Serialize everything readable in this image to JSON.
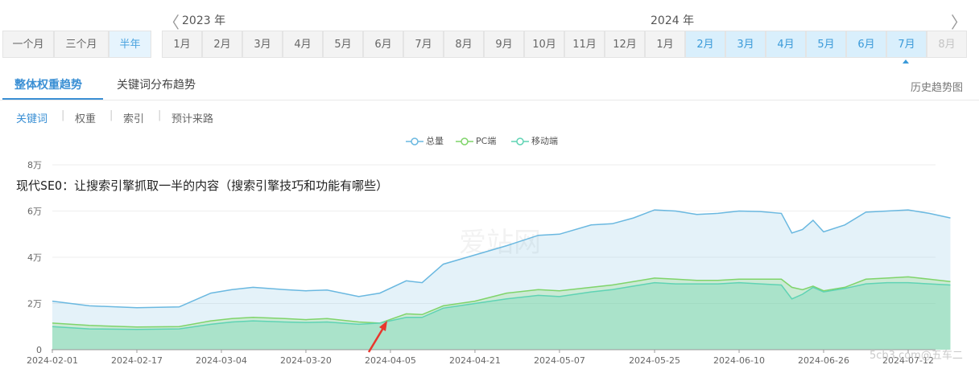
{
  "header": {
    "prev_arrow": "〈",
    "next_arrow": "〉",
    "year_2023": "2023 年",
    "year_2024": "2024 年",
    "range_buttons": [
      "一个月",
      "三个月",
      "半年"
    ],
    "months": [
      "1月",
      "2月",
      "3月",
      "4月",
      "5月",
      "6月",
      "7月",
      "8月",
      "9月",
      "10月",
      "11月",
      "12月",
      "1月",
      "2月",
      "3月",
      "4月",
      "5月",
      "6月",
      "7月",
      "8月"
    ]
  },
  "tabs": [
    "整体权重趋势",
    "关键词分布趋势"
  ],
  "history_link": "历史趋势图",
  "subtabs": [
    "关键词",
    "权重",
    "索引",
    "预计来路"
  ],
  "sep": "|",
  "overlay_title": "现代SEO：让搜索引擎抓取一半的内容（搜索引擎技巧和功能有哪些）",
  "watermark_text": "爱站网",
  "corner_watermark": "5cb3.com@五车二",
  "colors": {
    "total": "#6ab8e0",
    "pc": "#7fd46a",
    "mobile": "#5fd3b4",
    "accent": "#3a8fd4"
  },
  "chart_data": {
    "type": "area",
    "legend": [
      "总量",
      "PC端",
      "移动端"
    ],
    "x_ticks": [
      "2024-02-01",
      "2024-02-17",
      "2024-03-04",
      "2024-03-20",
      "2024-04-05",
      "2024-04-21",
      "2024-05-07",
      "2024-05-25",
      "2024-06-10",
      "2024-06-26",
      "2024-07-12"
    ],
    "y_ticks": [
      "0",
      "2万",
      "4万",
      "6万",
      "8万"
    ],
    "ylim": [
      0,
      80000
    ],
    "series": [
      {
        "name": "总量",
        "x": [
          "2024-02-01",
          "2024-02-08",
          "2024-02-17",
          "2024-02-25",
          "2024-03-02",
          "2024-03-06",
          "2024-03-10",
          "2024-03-16",
          "2024-03-20",
          "2024-03-24",
          "2024-03-30",
          "2024-04-03",
          "2024-04-08",
          "2024-04-11",
          "2024-04-15",
          "2024-04-21",
          "2024-04-27",
          "2024-05-03",
          "2024-05-07",
          "2024-05-13",
          "2024-05-17",
          "2024-05-21",
          "2024-05-25",
          "2024-05-29",
          "2024-06-02",
          "2024-06-06",
          "2024-06-10",
          "2024-06-14",
          "2024-06-18",
          "2024-06-20",
          "2024-06-22",
          "2024-06-24",
          "2024-06-26",
          "2024-06-30",
          "2024-07-04",
          "2024-07-08",
          "2024-07-12",
          "2024-07-16",
          "2024-07-20"
        ],
        "values": [
          21000,
          19000,
          18200,
          18500,
          24500,
          26000,
          27000,
          26000,
          25500,
          25800,
          23000,
          24500,
          29800,
          29000,
          37000,
          41000,
          45000,
          49500,
          50000,
          54000,
          54500,
          57000,
          60500,
          60000,
          58500,
          59000,
          60000,
          59800,
          59000,
          50500,
          52000,
          56000,
          51000,
          54000,
          59500,
          60000,
          60500,
          59000,
          57000
        ]
      },
      {
        "name": "PC端",
        "x": [
          "2024-02-01",
          "2024-02-08",
          "2024-02-17",
          "2024-02-25",
          "2024-03-02",
          "2024-03-06",
          "2024-03-10",
          "2024-03-16",
          "2024-03-20",
          "2024-03-24",
          "2024-03-30",
          "2024-04-03",
          "2024-04-08",
          "2024-04-11",
          "2024-04-15",
          "2024-04-21",
          "2024-04-27",
          "2024-05-03",
          "2024-05-07",
          "2024-05-13",
          "2024-05-17",
          "2024-05-21",
          "2024-05-25",
          "2024-05-29",
          "2024-06-02",
          "2024-06-06",
          "2024-06-10",
          "2024-06-14",
          "2024-06-18",
          "2024-06-20",
          "2024-06-22",
          "2024-06-24",
          "2024-06-26",
          "2024-06-30",
          "2024-07-04",
          "2024-07-08",
          "2024-07-12",
          "2024-07-16",
          "2024-07-20"
        ],
        "values": [
          11500,
          10500,
          9800,
          10000,
          12500,
          13500,
          14000,
          13500,
          13000,
          13500,
          12000,
          11500,
          15500,
          15200,
          19000,
          21000,
          24500,
          26000,
          25500,
          27000,
          28000,
          29500,
          31000,
          30500,
          30000,
          30000,
          30500,
          30500,
          30500,
          27000,
          26000,
          27500,
          25500,
          27000,
          30500,
          31000,
          31500,
          30500,
          29500
        ]
      },
      {
        "name": "移动端",
        "x": [
          "2024-02-01",
          "2024-02-08",
          "2024-02-17",
          "2024-02-25",
          "2024-03-02",
          "2024-03-06",
          "2024-03-10",
          "2024-03-16",
          "2024-03-20",
          "2024-03-24",
          "2024-03-30",
          "2024-04-03",
          "2024-04-08",
          "2024-04-11",
          "2024-04-15",
          "2024-04-21",
          "2024-04-27",
          "2024-05-03",
          "2024-05-07",
          "2024-05-13",
          "2024-05-17",
          "2024-05-21",
          "2024-05-25",
          "2024-05-29",
          "2024-06-02",
          "2024-06-06",
          "2024-06-10",
          "2024-06-14",
          "2024-06-18",
          "2024-06-20",
          "2024-06-22",
          "2024-06-24",
          "2024-06-26",
          "2024-06-30",
          "2024-07-04",
          "2024-07-08",
          "2024-07-12",
          "2024-07-16",
          "2024-07-20"
        ],
        "values": [
          10000,
          9000,
          8800,
          9000,
          11000,
          12000,
          12500,
          12000,
          11800,
          12000,
          11000,
          11500,
          14000,
          14000,
          18000,
          20000,
          22000,
          23500,
          23000,
          25000,
          26000,
          27500,
          29000,
          28500,
          28500,
          28500,
          29000,
          28500,
          28000,
          22000,
          24000,
          27000,
          25000,
          26500,
          28500,
          29000,
          29000,
          28500,
          28000
        ]
      }
    ]
  }
}
